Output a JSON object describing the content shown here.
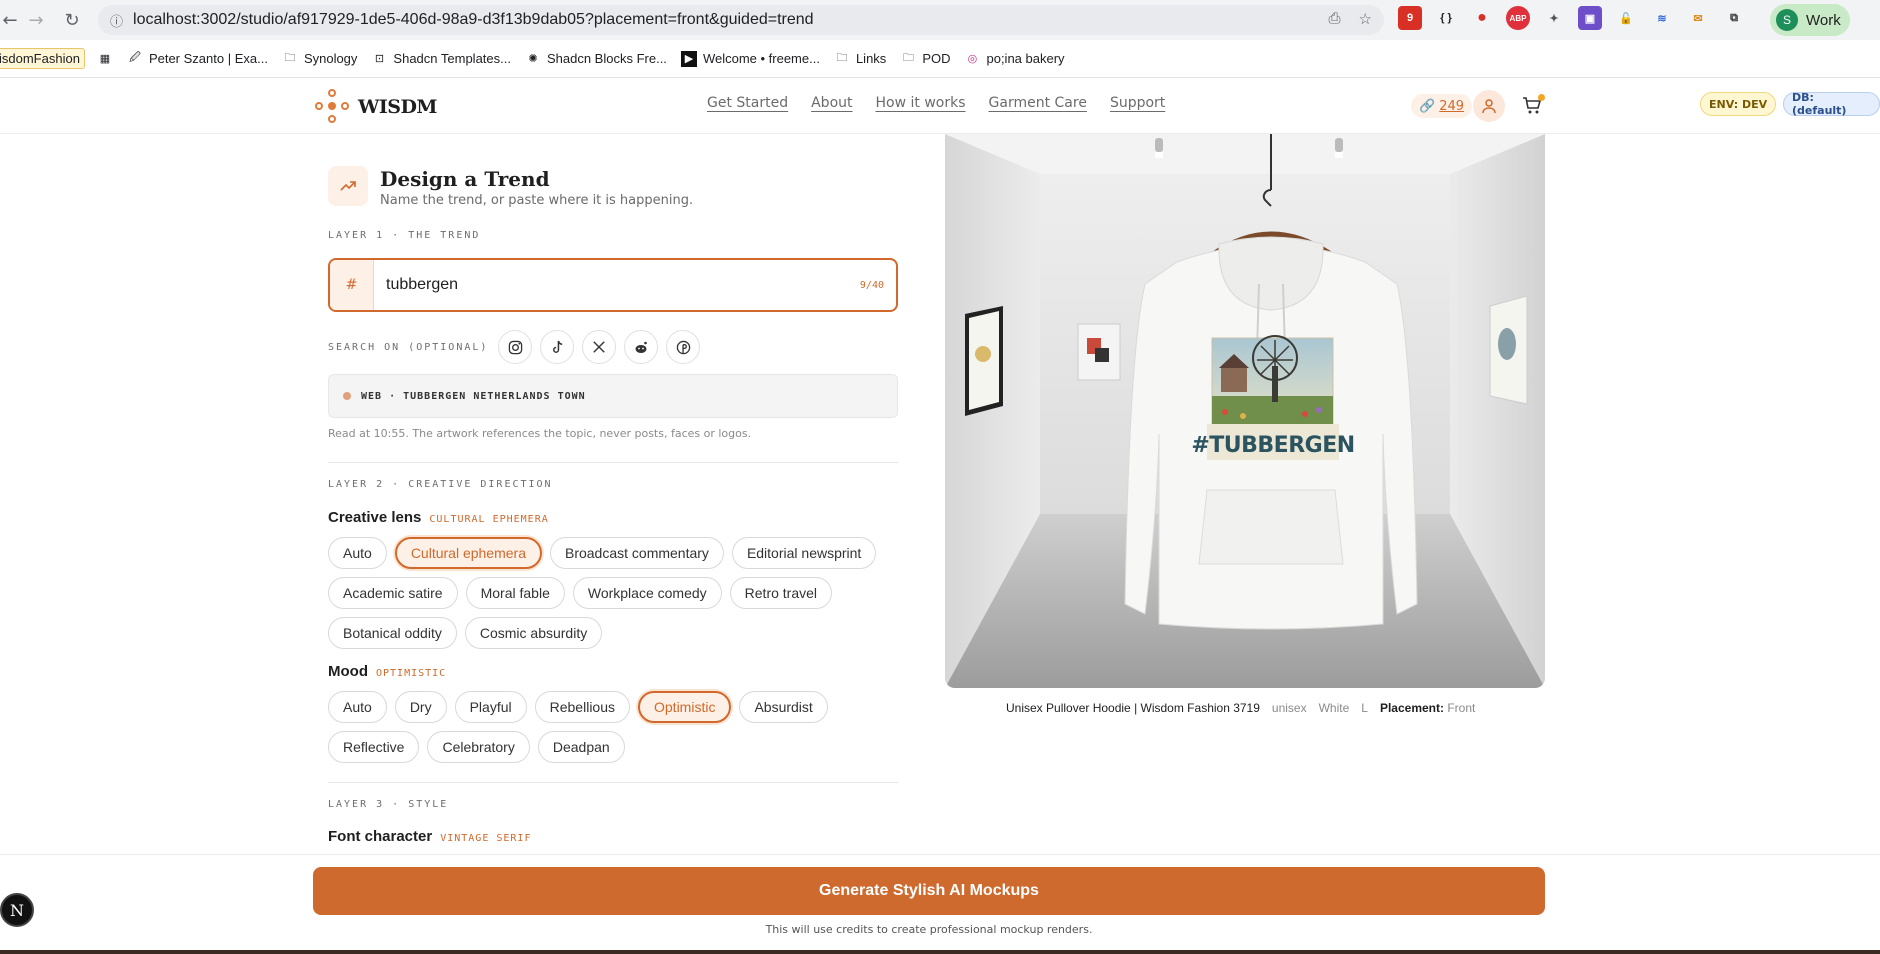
{
  "browser": {
    "url": "localhost:3002/studio/af917929-1de5-406d-98a9-d3f13b9dab05?placement=front&guided=trend",
    "profile_initial": "S",
    "profile_label": "Work",
    "bookmarks": [
      "isdomFashion",
      "Peter Szanto | Exa...",
      "Synology",
      "Shadcn Templates...",
      "Shadcn Blocks Fre...",
      "Welcome • freeme...",
      "Links",
      "POD",
      "po;ina bakery"
    ]
  },
  "header": {
    "brand": "WISDM",
    "nav": [
      "Get Started",
      "About",
      "How it works",
      "Garment Care",
      "Support"
    ],
    "credits": "249",
    "env_badge": "ENV: DEV",
    "db_badge": "DB: (default)"
  },
  "design": {
    "title": "Design a Trend",
    "subtitle": "Name the trend, or paste where it is happening.",
    "layer1_label": "LAYER 1 · THE TREND",
    "hash": "#",
    "trend_value": "tubbergen",
    "char_count": "9/40",
    "search_label": "SEARCH ON (OPTIONAL)",
    "web_chip": "WEB · TUBBERGEN NETHERLANDS TOWN",
    "read_note": "Read at 10:55. The artwork references the topic, never posts, faces or logos.",
    "layer2_label": "LAYER 2 · CREATIVE DIRECTION",
    "lens_label": "Creative lens",
    "lens_value": "CULTURAL EPHEMERA",
    "lens_options": [
      "Auto",
      "Cultural ephemera",
      "Broadcast commentary",
      "Editorial newsprint",
      "Academic satire",
      "Moral fable",
      "Workplace comedy",
      "Retro travel",
      "Botanical oddity",
      "Cosmic absurdity"
    ],
    "lens_selected": 1,
    "mood_label": "Mood",
    "mood_value": "OPTIMISTIC",
    "mood_options": [
      "Auto",
      "Dry",
      "Playful",
      "Rebellious",
      "Optimistic",
      "Absurdist",
      "Reflective",
      "Celebratory",
      "Deadpan"
    ],
    "mood_selected": 4,
    "layer3_label": "LAYER 3 · STYLE",
    "font_label": "Font character",
    "font_value": "VINTAGE SERIF"
  },
  "preview": {
    "product": "Unisex Pullover Hoodie | Wisdom Fashion 3719",
    "gender": "unisex",
    "color": "White",
    "size": "L",
    "placement_label": "Placement:",
    "placement_value": "Front",
    "print_text": "#TUBBERGEN"
  },
  "generate": {
    "button": "Generate Stylish AI Mockups",
    "note": "This will use credits to create professional mockup renders."
  },
  "dev_badge": "N",
  "colors": {
    "accent": "#d0692b",
    "accent_bg": "#fdf1e7"
  }
}
